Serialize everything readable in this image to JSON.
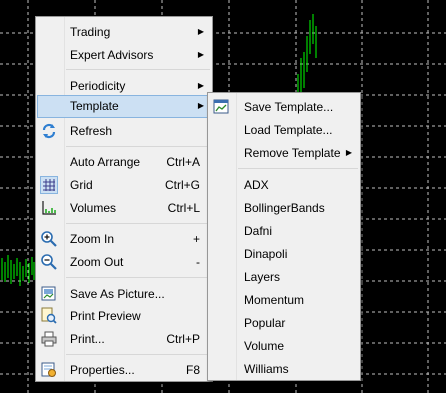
{
  "main_menu": {
    "items": [
      {
        "label": "Trading",
        "shortcut": "",
        "submenu": true
      },
      {
        "label": "Expert Advisors",
        "shortcut": "",
        "submenu": true
      },
      {
        "label": "Periodicity",
        "shortcut": "",
        "submenu": true
      },
      {
        "label": "Template",
        "shortcut": "",
        "submenu": true
      },
      {
        "label": "Refresh",
        "shortcut": "",
        "icon": "refresh-icon"
      },
      {
        "label": "Auto Arrange",
        "shortcut": "Ctrl+A"
      },
      {
        "label": "Grid",
        "shortcut": "Ctrl+G",
        "icon": "grid-icon"
      },
      {
        "label": "Volumes",
        "shortcut": "Ctrl+L",
        "icon": "volumes-icon"
      },
      {
        "label": "Zoom In",
        "shortcut": "+",
        "icon": "zoom-in-icon"
      },
      {
        "label": "Zoom Out",
        "shortcut": "-",
        "icon": "zoom-out-icon"
      },
      {
        "label": "Save As Picture...",
        "shortcut": "",
        "icon": "save-picture-icon"
      },
      {
        "label": "Print Preview",
        "shortcut": "",
        "icon": "print-preview-icon"
      },
      {
        "label": "Print...",
        "shortcut": "Ctrl+P",
        "icon": "printer-icon"
      },
      {
        "label": "Properties...",
        "shortcut": "F8",
        "icon": "properties-icon"
      }
    ]
  },
  "template_submenu": {
    "items": [
      {
        "label": "Save Template...",
        "icon": "save-template-icon"
      },
      {
        "label": "Load Template..."
      },
      {
        "label": "Remove Template",
        "submenu": true
      },
      {
        "label": "ADX"
      },
      {
        "label": "BollingerBands"
      },
      {
        "label": "Dafni"
      },
      {
        "label": "Dinapoli"
      },
      {
        "label": "Layers"
      },
      {
        "label": "Momentum"
      },
      {
        "label": "Popular"
      },
      {
        "label": "Volume"
      },
      {
        "label": "Williams"
      }
    ]
  },
  "colors": {
    "background": "#000000",
    "grid": "#c0c0c0",
    "candles": "#00ff00",
    "highlight": "#cce0f3"
  }
}
